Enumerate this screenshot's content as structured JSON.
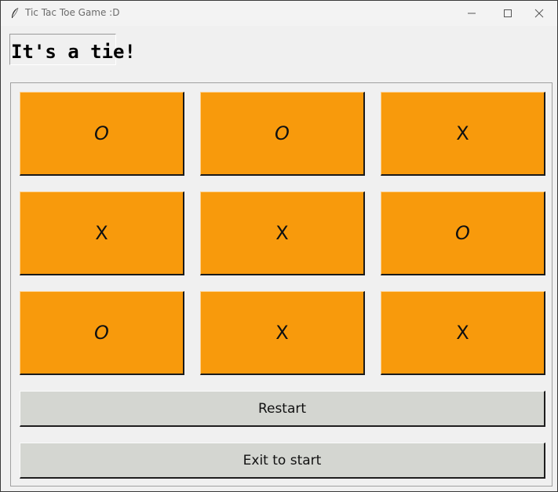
{
  "window": {
    "title": "Tic Tac Toe Game :D",
    "icon": "feather-icon"
  },
  "controls": {
    "minimize_icon": "minimize-icon",
    "maximize_icon": "maximize-icon",
    "close_icon": "close-icon"
  },
  "status": {
    "text": "It's a tie!"
  },
  "board": {
    "cells": [
      [
        "O",
        "O",
        "X"
      ],
      [
        "X",
        "X",
        "O"
      ],
      [
        "O",
        "X",
        "X"
      ]
    ]
  },
  "buttons": {
    "restart_label": "Restart",
    "exit_label": "Exit to start"
  },
  "colors": {
    "cell_background": "#f89a0c",
    "button_background": "#d4d6d1",
    "window_background": "#f0f0f0"
  }
}
